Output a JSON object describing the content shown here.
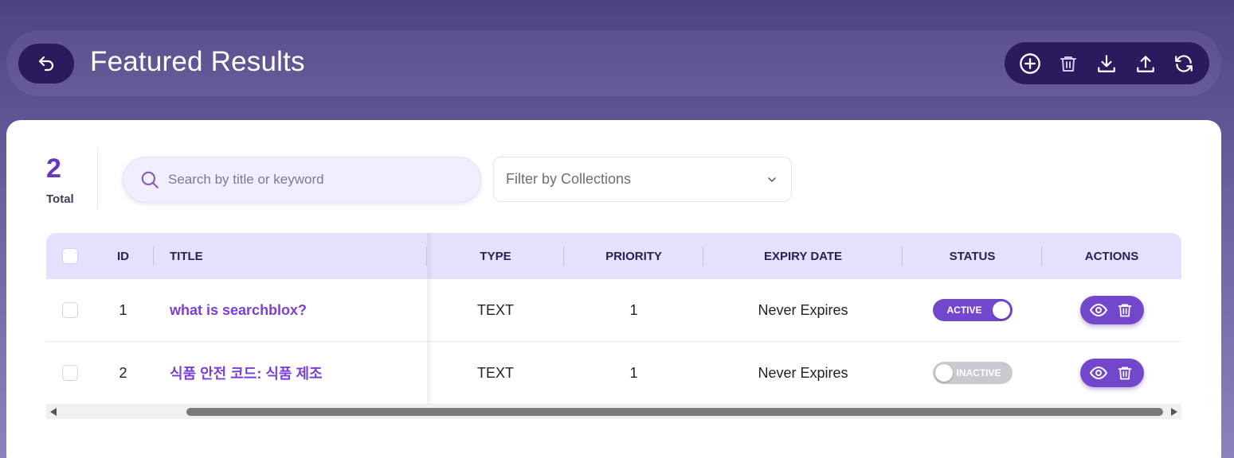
{
  "header": {
    "title": "Featured Results",
    "back_icon": "undo-arrow-icon",
    "toolbar_icons": [
      "add-circle-icon",
      "trash-icon",
      "download-icon",
      "upload-icon",
      "refresh-icon"
    ]
  },
  "summary": {
    "count": "2",
    "label": "Total"
  },
  "search": {
    "placeholder": "Search by title or keyword",
    "value": ""
  },
  "filter": {
    "placeholder": "Filter by Collections"
  },
  "table": {
    "columns": [
      "ID",
      "TITLE",
      "TYPE",
      "PRIORITY",
      "EXPIRY DATE",
      "STATUS",
      "ACTIONS"
    ],
    "rows": [
      {
        "id": "1",
        "title": "what is searchblox?",
        "type": "TEXT",
        "priority": "1",
        "expiry": "Never Expires",
        "status": "ACTIVE",
        "active": true
      },
      {
        "id": "2",
        "title": "식품 안전 코드: 식품 제조",
        "type": "TEXT",
        "priority": "1",
        "expiry": "Never Expires",
        "status": "INACTIVE",
        "active": false
      }
    ]
  },
  "colors": {
    "accent": "#7347cc",
    "dark": "#2b1a5e",
    "header_bg": "#e6e0fd"
  }
}
